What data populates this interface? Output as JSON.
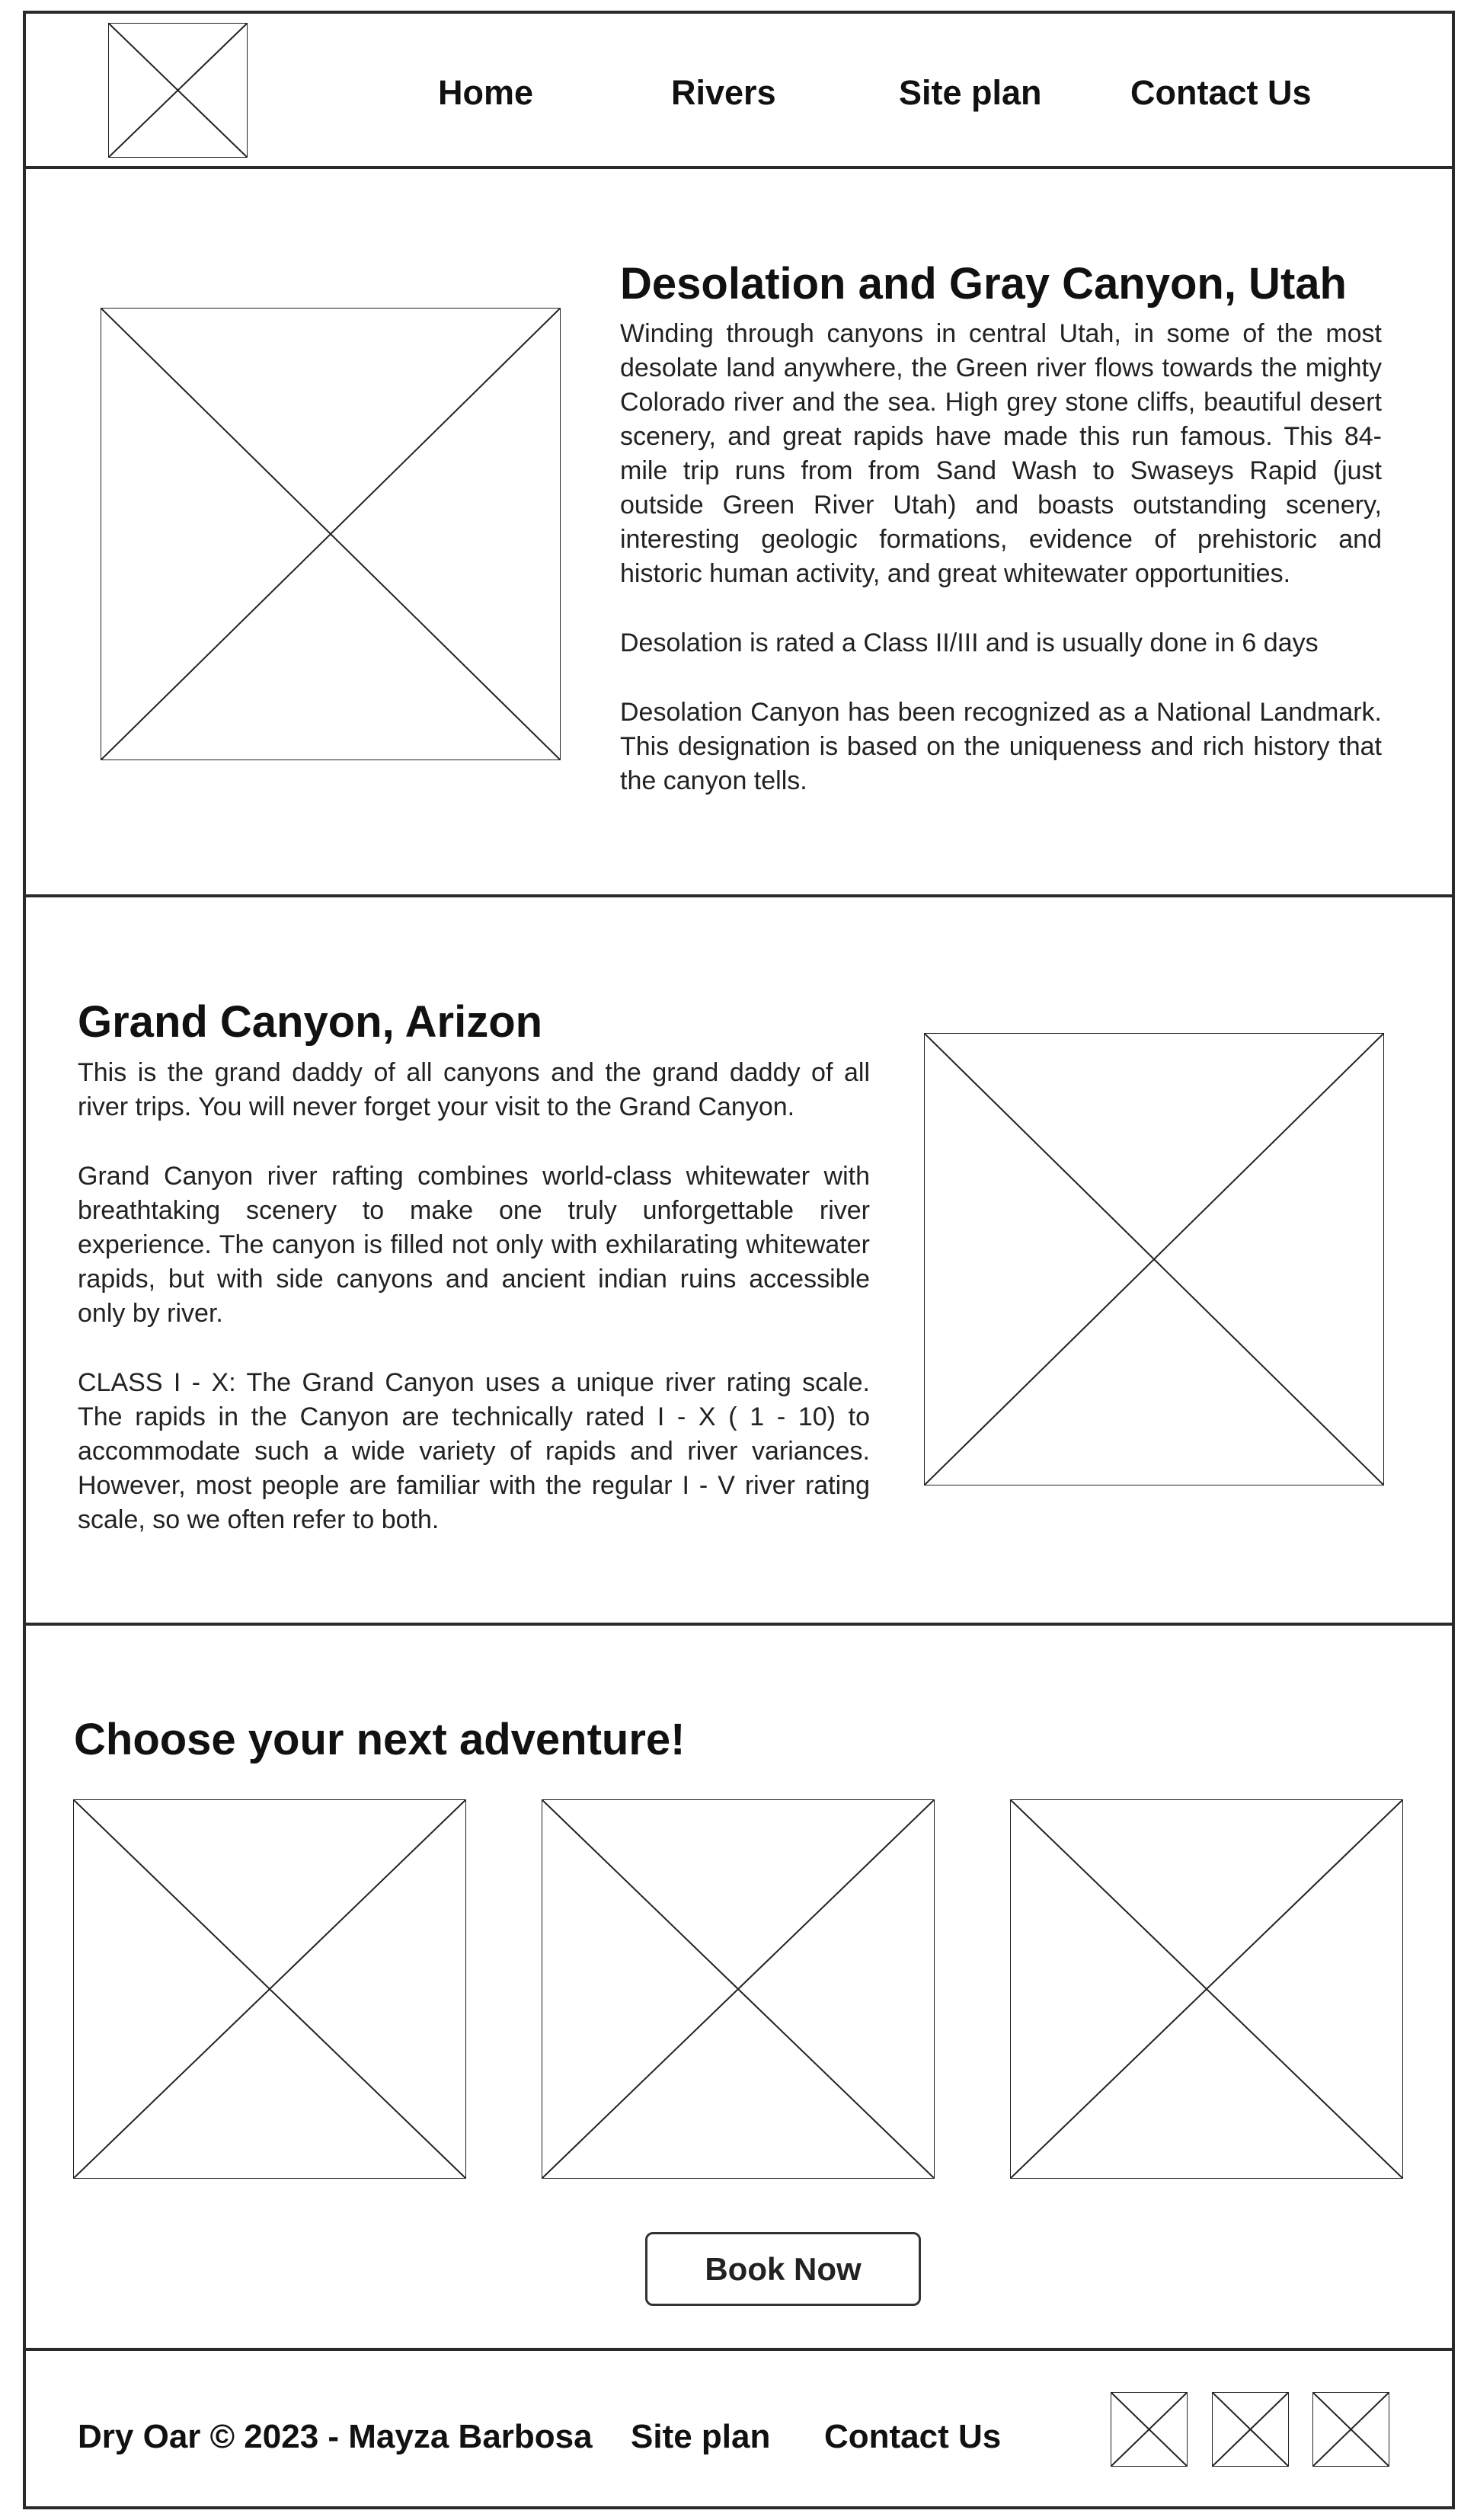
{
  "header": {
    "logo_icon": "image-placeholder-icon",
    "nav": [
      {
        "label": "Home"
      },
      {
        "label": "Rivers"
      },
      {
        "label": "Site plan"
      },
      {
        "label": "Contact Us"
      }
    ]
  },
  "desolation": {
    "title": "Desolation and Gray Canyon, Utah",
    "paragraphs": [
      "Winding through canyons in central Utah, in some of the most desolate land anywhere, the Green river flows towards the mighty Colorado river and the sea. High grey stone cliffs, beautiful desert scenery, and great rapids have made this run famous. This 84-mile trip runs from from Sand Wash to Swaseys Rapid (just outside Green River Utah) and boasts outstanding scenery, interesting geologic formations, evidence of prehistoric and historic human activity, and great whitewater opportunities.",
      "Desolation is rated a Class II/III and is usually done in 6 days",
      "Desolation Canyon has been recognized as a National Landmark.  This designation is based on the uniqueness and rich history that the canyon tells."
    ]
  },
  "grand_canyon": {
    "title": "Grand Canyon, Arizon",
    "paragraphs": [
      "This is the grand daddy of all canyons and the grand daddy of all river trips. You will never forget your visit to the Grand Canyon.",
      "Grand Canyon river rafting combines world-class whitewater with breathtaking scenery to make one truly unforgettable river experience. The canyon is filled not only with exhilarating whitewater rapids, but with side canyons and ancient indian ruins accessible only by river.",
      "CLASS I - X: The Grand Canyon uses a unique river rating scale. The rapids in the Canyon are technically rated I - X ( 1 - 10) to accommodate such a wide variety of rapids and river variances. However, most people are familiar with the regular I - V river rating scale, so we often refer to both."
    ]
  },
  "adventure": {
    "title": "Choose your next adventure!",
    "button_label": "Book Now"
  },
  "footer": {
    "copyright": "Dry Oar © 2023 - Mayza Barbosa",
    "links": [
      {
        "label": "Site plan"
      },
      {
        "label": "Contact Us"
      }
    ],
    "social_icons": [
      "image-placeholder-icon",
      "image-placeholder-icon",
      "image-placeholder-icon"
    ]
  }
}
